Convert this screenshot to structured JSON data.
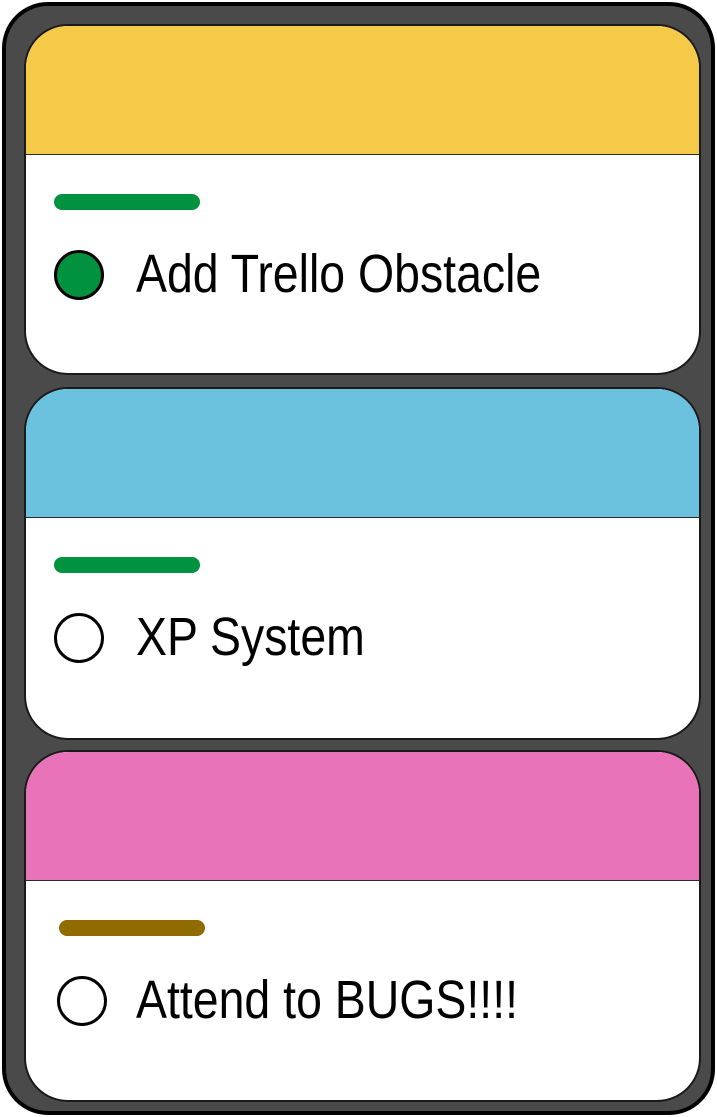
{
  "cards": [
    {
      "title": "Add Trello Obstacle",
      "cover_color": "#f5ca48",
      "label_color": "#00923f",
      "completed": true
    },
    {
      "title": "XP System",
      "cover_color": "#6ac2df",
      "label_color": "#00923f",
      "completed": false
    },
    {
      "title": "Attend to BUGS!!!!",
      "cover_color": "#e873b8",
      "label_color": "#8f6b00",
      "completed": false
    }
  ],
  "icons": {
    "complete_check": "filled-circle-icon",
    "incomplete_check": "empty-circle-icon"
  }
}
